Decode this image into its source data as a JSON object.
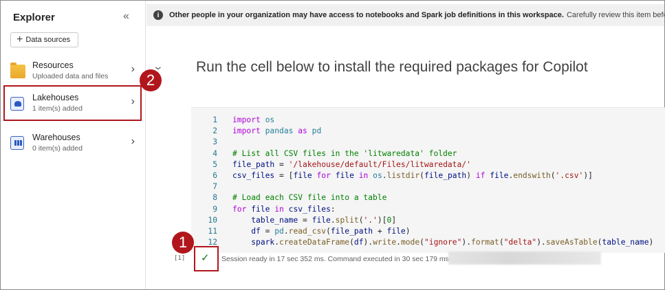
{
  "explorer": {
    "title": "Explorer",
    "collapse_icon": "«",
    "data_sources_label": "Data sources",
    "items": [
      {
        "name": "Resources",
        "sub": "Uploaded data and files",
        "icon": "folder-icon"
      },
      {
        "name": "Lakehouses",
        "sub": "1 item(s) added",
        "icon": "lakehouse-icon"
      },
      {
        "name": "Warehouses",
        "sub": "0 item(s) added",
        "icon": "warehouse-icon"
      }
    ]
  },
  "banner": {
    "bold": "Other people in your organization may have access to notebooks and Spark job definitions in this workspace.",
    "rest": "Carefully review this item before ru"
  },
  "notebook": {
    "markdown_text": "Run the cell below to install the required packages for Copilot",
    "execution_count": "[1]",
    "status_text": "Session ready in 17 sec 352 ms. Command executed in 30 sec 179 ms",
    "code_lines": [
      "import os",
      "import pandas as pd",
      "",
      "# List all CSV files in the 'litwaredata' folder",
      "file_path = '/lakehouse/default/Files/litwaredata/'",
      "csv_files = [file for file in os.listdir(file_path) if file.endswith('.csv')]",
      "",
      "# Load each CSV file into a table",
      "for file in csv_files:",
      "    table_name = file.split('.')[0]",
      "    df = pd.read_csv(file_path + file)",
      "    spark.createDataFrame(df).write.mode(\"ignore\").format(\"delta\").saveAsTable(table_name)"
    ]
  },
  "callouts": {
    "one": "1",
    "two": "2"
  },
  "colors": {
    "accent_red": "#b0161b",
    "success_green": "#107c10"
  }
}
